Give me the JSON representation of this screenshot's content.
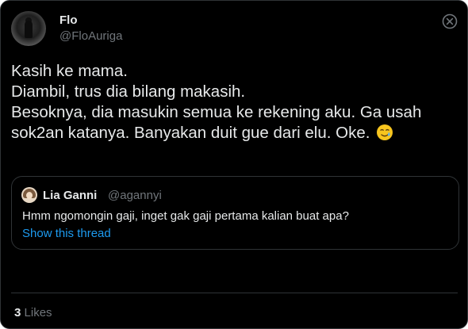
{
  "author": {
    "display_name": "Flo",
    "handle": "@FloAuriga"
  },
  "tweet": {
    "lines": [
      "Kasih ke mama.",
      "Diambil, trus dia bilang makasih.",
      "Besoknya, dia masukin semua ke rekening aku. Ga usah",
      "sok2an katanya. Banyakan duit gue dari elu. Oke."
    ],
    "emoji": "face-with-tear-emoji"
  },
  "quote": {
    "display_name": "Lia Ganni",
    "handle": "@agannyi",
    "text": "Hmm ngomongin gaji, inget gak gaji pertama kalian buat apa?",
    "link_label": "Show this thread"
  },
  "stats": {
    "likes_count": "3",
    "likes_label": "Likes"
  },
  "colors": {
    "background": "#000000",
    "border": "#2f3336",
    "text": "#e7e9ea",
    "secondary_text": "#71767b",
    "link": "#1d9bf0"
  },
  "icons": {
    "close": "close-icon"
  }
}
